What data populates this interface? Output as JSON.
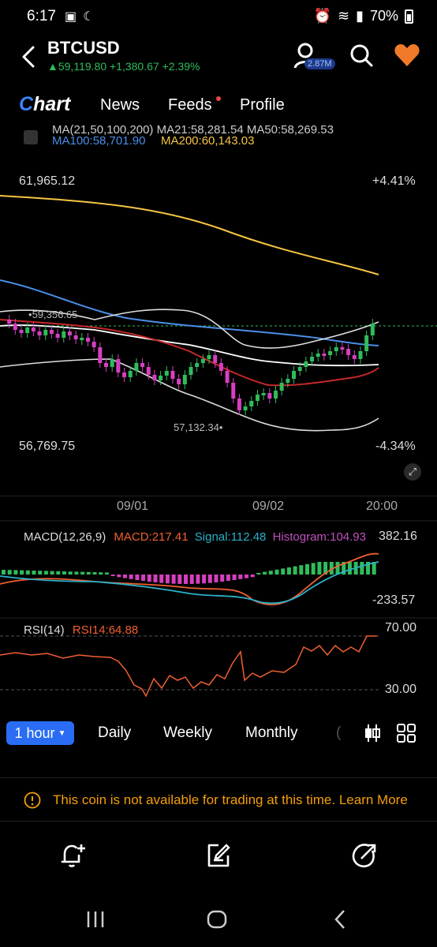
{
  "status": {
    "time": "6:17",
    "battery": "70%"
  },
  "header": {
    "ticker": "BTCUSD",
    "price": "59,119.80",
    "change": "+1,380.67",
    "change_pct": "+2.39%",
    "followers": "2.87M"
  },
  "tabs": {
    "chart": "Chart",
    "news": "News",
    "feeds": "Feeds",
    "profile": "Profile"
  },
  "ma": {
    "row1": "MA(21,50,100,200) MA21:58,281.54 MA50:58,269.53",
    "ma100": "MA100:58,701.90",
    "ma200": "MA200:60,143.03"
  },
  "price_panel": {
    "top_price": "61,965.12",
    "top_pct": "+4.41%",
    "bottom_price": "56,769.75",
    "bottom_pct": "-4.34%",
    "high_marker": "59,356.65",
    "low_marker": "57,132.34"
  },
  "xaxis": {
    "d1": "09/01",
    "d2": "09/02",
    "d3": "20:00"
  },
  "macd": {
    "title": "MACD(12,26,9)",
    "macd": "MACD:217.41",
    "signal": "Signal:112.48",
    "hist": "Histogram:104.93",
    "max": "382.16",
    "min": "-233.57"
  },
  "rsi": {
    "title": "RSI(14)",
    "value": "RSI14:64.88",
    "upper": "70.00",
    "lower": "30.00"
  },
  "timeframes": {
    "active": "1 hour",
    "daily": "Daily",
    "weekly": "Weekly",
    "monthly": "Monthly"
  },
  "notice": "This coin is not available for trading at this time. Learn More",
  "colors": {
    "up": "#2ebd5c",
    "down": "#d63fbf",
    "accent": "#2a6df4",
    "warn": "#f59e0b"
  }
}
